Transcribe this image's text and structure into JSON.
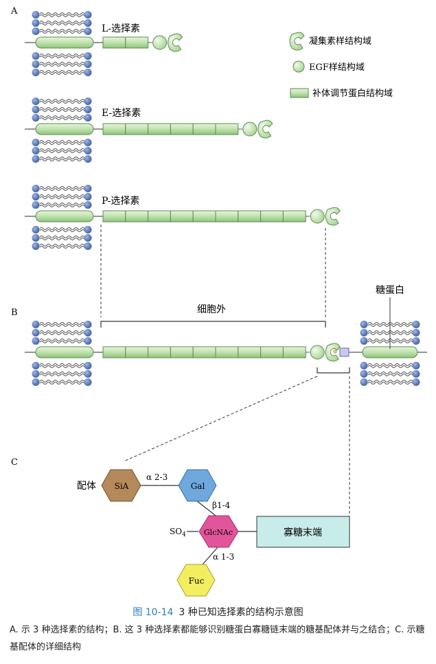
{
  "panels": {
    "a": "A",
    "b": "B",
    "c": "C"
  },
  "selectins": {
    "l": "L-选择素",
    "e": "E-选择素",
    "p": "P-选择素",
    "l_cr_count": 2,
    "e_cr_count": 6,
    "p_cr_count": 9
  },
  "legend": {
    "lectin": "凝集素样结构域",
    "egf": "EGF样结构域",
    "cr": "补体调节蛋白结构域"
  },
  "panel_b": {
    "extracellular": "细胞外",
    "glycoprotein": "糖蛋白"
  },
  "panel_c": {
    "ligand_label": "配体",
    "sia": "SiA",
    "gal": "Gal",
    "glcnac": "GlcNAc",
    "fuc": "Fuc",
    "bond_sia_gal": "α 2-3",
    "bond_gal_glcnac": "β1-4",
    "bond_glcnac_fuc": "α 1-3",
    "so4": "SO",
    "so4_sub": "4",
    "oligo_end": "寡糖末端"
  },
  "colors": {
    "lipid_head": "#5b79b8",
    "bar_fill": "#c6e6b6",
    "bar_stroke": "#5c8a50",
    "sia": "#b58a5a",
    "gal": "#6fa8dc",
    "glcnac": "#e2559a",
    "fuc": "#f2ee60",
    "oligo_box": "#c8ecea",
    "caption_blue": "#2a7fc4"
  },
  "caption": {
    "number": "图 10-14",
    "title": "3 种已知选择素的结构示意图",
    "description": "A. 示 3 种选择素的结构；B. 这 3 种选择素都能够识别糖蛋白寡糖链末端的糖基配体并与之结合；C. 示糖基配体的详细结构"
  }
}
